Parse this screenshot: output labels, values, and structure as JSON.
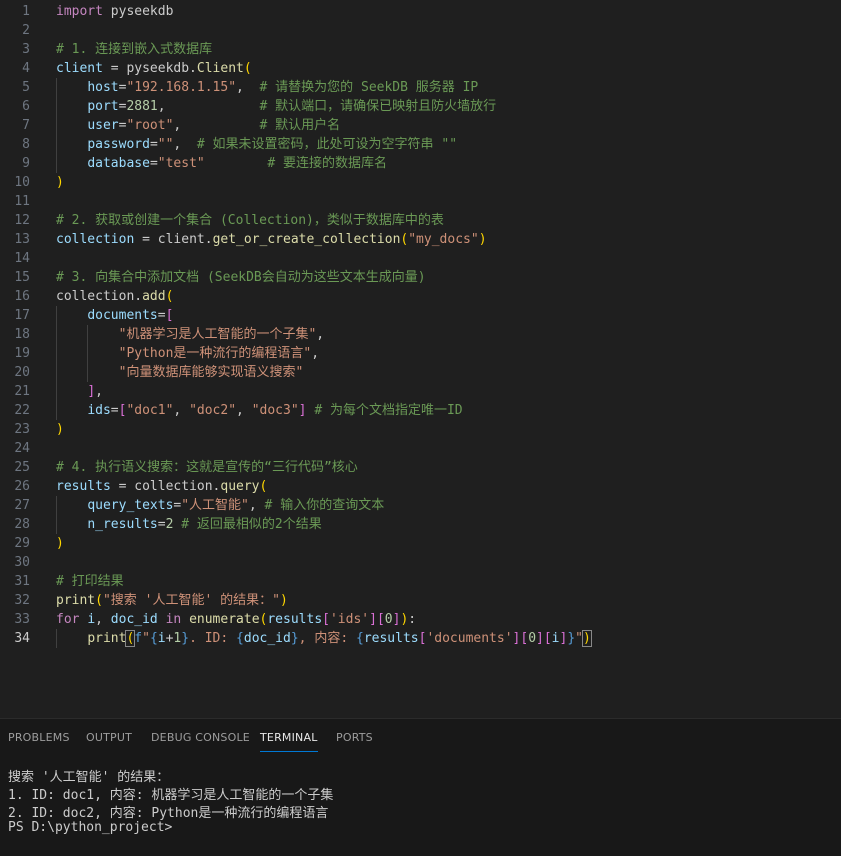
{
  "editor": {
    "active_line": 34,
    "lines": [
      [
        [
          "kw",
          "import"
        ],
        [
          "pl",
          " pyseekdb"
        ]
      ],
      [],
      [
        [
          "cm",
          "# 1. 连接到嵌入式数据库"
        ]
      ],
      [
        [
          "var",
          "client"
        ],
        [
          "pl",
          " = pyseekdb."
        ],
        [
          "fn",
          "Client"
        ],
        [
          "b1",
          "("
        ]
      ],
      [
        [
          "pl",
          "    "
        ],
        [
          "var",
          "host"
        ],
        [
          "pl",
          "="
        ],
        [
          "str",
          "\"192.168.1.15\""
        ],
        [
          "pl",
          ",  "
        ],
        [
          "cm",
          "# 请替换为您的 SeekDB 服务器 IP"
        ]
      ],
      [
        [
          "pl",
          "    "
        ],
        [
          "var",
          "port"
        ],
        [
          "pl",
          "="
        ],
        [
          "num",
          "2881"
        ],
        [
          "pl",
          ",            "
        ],
        [
          "cm",
          "# 默认端口，请确保已映射且防火墙放行"
        ]
      ],
      [
        [
          "pl",
          "    "
        ],
        [
          "var",
          "user"
        ],
        [
          "pl",
          "="
        ],
        [
          "str",
          "\"root\""
        ],
        [
          "pl",
          ",          "
        ],
        [
          "cm",
          "# 默认用户名"
        ]
      ],
      [
        [
          "pl",
          "    "
        ],
        [
          "var",
          "password"
        ],
        [
          "pl",
          "="
        ],
        [
          "str",
          "\"\""
        ],
        [
          "pl",
          ",  "
        ],
        [
          "cm",
          "# 如果未设置密码，此处可设为空字符串 \"\""
        ]
      ],
      [
        [
          "pl",
          "    "
        ],
        [
          "var",
          "database"
        ],
        [
          "pl",
          "="
        ],
        [
          "str",
          "\"test\""
        ],
        [
          "pl",
          "        "
        ],
        [
          "cm",
          "# 要连接的数据库名"
        ]
      ],
      [
        [
          "b1",
          ")"
        ]
      ],
      [],
      [
        [
          "cm",
          "# 2. 获取或创建一个集合 (Collection)，类似于数据库中的表"
        ]
      ],
      [
        [
          "var",
          "collection"
        ],
        [
          "pl",
          " = client."
        ],
        [
          "fn",
          "get_or_create_collection"
        ],
        [
          "b1",
          "("
        ],
        [
          "str",
          "\"my_docs\""
        ],
        [
          "b1",
          ")"
        ]
      ],
      [],
      [
        [
          "cm",
          "# 3. 向集合中添加文档 (SeekDB会自动为这些文本生成向量)"
        ]
      ],
      [
        [
          "pl",
          "collection."
        ],
        [
          "fn",
          "add"
        ],
        [
          "b1",
          "("
        ]
      ],
      [
        [
          "pl",
          "    "
        ],
        [
          "var",
          "documents"
        ],
        [
          "pl",
          "="
        ],
        [
          "b2",
          "["
        ]
      ],
      [
        [
          "pl",
          "        "
        ],
        [
          "str",
          "\"机器学习是人工智能的一个子集\""
        ],
        [
          "pl",
          ","
        ]
      ],
      [
        [
          "pl",
          "        "
        ],
        [
          "str",
          "\"Python是一种流行的编程语言\""
        ],
        [
          "pl",
          ","
        ]
      ],
      [
        [
          "pl",
          "        "
        ],
        [
          "str",
          "\"向量数据库能够实现语义搜索\""
        ]
      ],
      [
        [
          "pl",
          "    "
        ],
        [
          "b2",
          "]"
        ],
        [
          "pl",
          ","
        ]
      ],
      [
        [
          "pl",
          "    "
        ],
        [
          "var",
          "ids"
        ],
        [
          "pl",
          "="
        ],
        [
          "b2",
          "["
        ],
        [
          "str",
          "\"doc1\""
        ],
        [
          "pl",
          ", "
        ],
        [
          "str",
          "\"doc2\""
        ],
        [
          "pl",
          ", "
        ],
        [
          "str",
          "\"doc3\""
        ],
        [
          "b2",
          "]"
        ],
        [
          "pl",
          " "
        ],
        [
          "cm",
          "# 为每个文档指定唯一ID"
        ]
      ],
      [
        [
          "b1",
          ")"
        ]
      ],
      [],
      [
        [
          "cm",
          "# 4. 执行语义搜索：这就是宣传的“三行代码”核心"
        ]
      ],
      [
        [
          "var",
          "results"
        ],
        [
          "pl",
          " = collection."
        ],
        [
          "fn",
          "query"
        ],
        [
          "b1",
          "("
        ]
      ],
      [
        [
          "pl",
          "    "
        ],
        [
          "var",
          "query_texts"
        ],
        [
          "pl",
          "="
        ],
        [
          "str",
          "\"人工智能\""
        ],
        [
          "pl",
          ", "
        ],
        [
          "cm",
          "# 输入你的查询文本"
        ]
      ],
      [
        [
          "pl",
          "    "
        ],
        [
          "var",
          "n_results"
        ],
        [
          "pl",
          "="
        ],
        [
          "num",
          "2"
        ],
        [
          "pl",
          " "
        ],
        [
          "cm",
          "# 返回最相似的2个结果"
        ]
      ],
      [
        [
          "b1",
          ")"
        ]
      ],
      [],
      [
        [
          "cm",
          "# 打印结果"
        ]
      ],
      [
        [
          "fn",
          "print"
        ],
        [
          "b1",
          "("
        ],
        [
          "str",
          "\"搜索 '人工智能' 的结果：\""
        ],
        [
          "b1",
          ")"
        ]
      ],
      [
        [
          "kw",
          "for"
        ],
        [
          "pl",
          " "
        ],
        [
          "var",
          "i"
        ],
        [
          "pl",
          ", "
        ],
        [
          "var",
          "doc_id"
        ],
        [
          "pl",
          " "
        ],
        [
          "kw",
          "in"
        ],
        [
          "pl",
          " "
        ],
        [
          "fn",
          "enumerate"
        ],
        [
          "b1",
          "("
        ],
        [
          "var",
          "results"
        ],
        [
          "b2",
          "["
        ],
        [
          "str",
          "'ids'"
        ],
        [
          "b2",
          "]"
        ],
        [
          "b2",
          "["
        ],
        [
          "num",
          "0"
        ],
        [
          "b2",
          "]"
        ],
        [
          "b1",
          ")"
        ],
        [
          "pl",
          ":"
        ]
      ],
      [
        [
          "pl",
          "    "
        ],
        [
          "fn",
          "print"
        ],
        [
          "b1m",
          "("
        ],
        [
          "kb",
          "f"
        ],
        [
          "str",
          "\""
        ],
        [
          "kb",
          "{"
        ],
        [
          "var",
          "i"
        ],
        [
          "pl",
          "+"
        ],
        [
          "num",
          "1"
        ],
        [
          "kb",
          "}"
        ],
        [
          "str",
          ". ID: "
        ],
        [
          "kb",
          "{"
        ],
        [
          "var",
          "doc_id"
        ],
        [
          "kb",
          "}"
        ],
        [
          "str",
          ", 内容: "
        ],
        [
          "kb",
          "{"
        ],
        [
          "var",
          "results"
        ],
        [
          "b2",
          "["
        ],
        [
          "str",
          "'documents'"
        ],
        [
          "b2",
          "]"
        ],
        [
          "b2",
          "["
        ],
        [
          "num",
          "0"
        ],
        [
          "b2",
          "]"
        ],
        [
          "b2",
          "["
        ],
        [
          "var",
          "i"
        ],
        [
          "b2",
          "]"
        ],
        [
          "kb",
          "}"
        ],
        [
          "str",
          "\""
        ],
        [
          "b1m",
          ")"
        ]
      ]
    ]
  },
  "panel": {
    "tabs": [
      {
        "label": "PROBLEMS",
        "active": false
      },
      {
        "label": "OUTPUT",
        "active": false
      },
      {
        "label": "DEBUG CONSOLE",
        "active": false
      },
      {
        "label": "TERMINAL",
        "active": true
      },
      {
        "label": "PORTS",
        "active": false
      }
    ],
    "terminal_lines": [
      "搜索 '人工智能' 的结果：",
      "1. ID: doc1, 内容: 机器学习是人工智能的一个子集",
      "2. ID: doc2, 内容: Python是一种流行的编程语言",
      "PS D:\\python_project>"
    ]
  }
}
